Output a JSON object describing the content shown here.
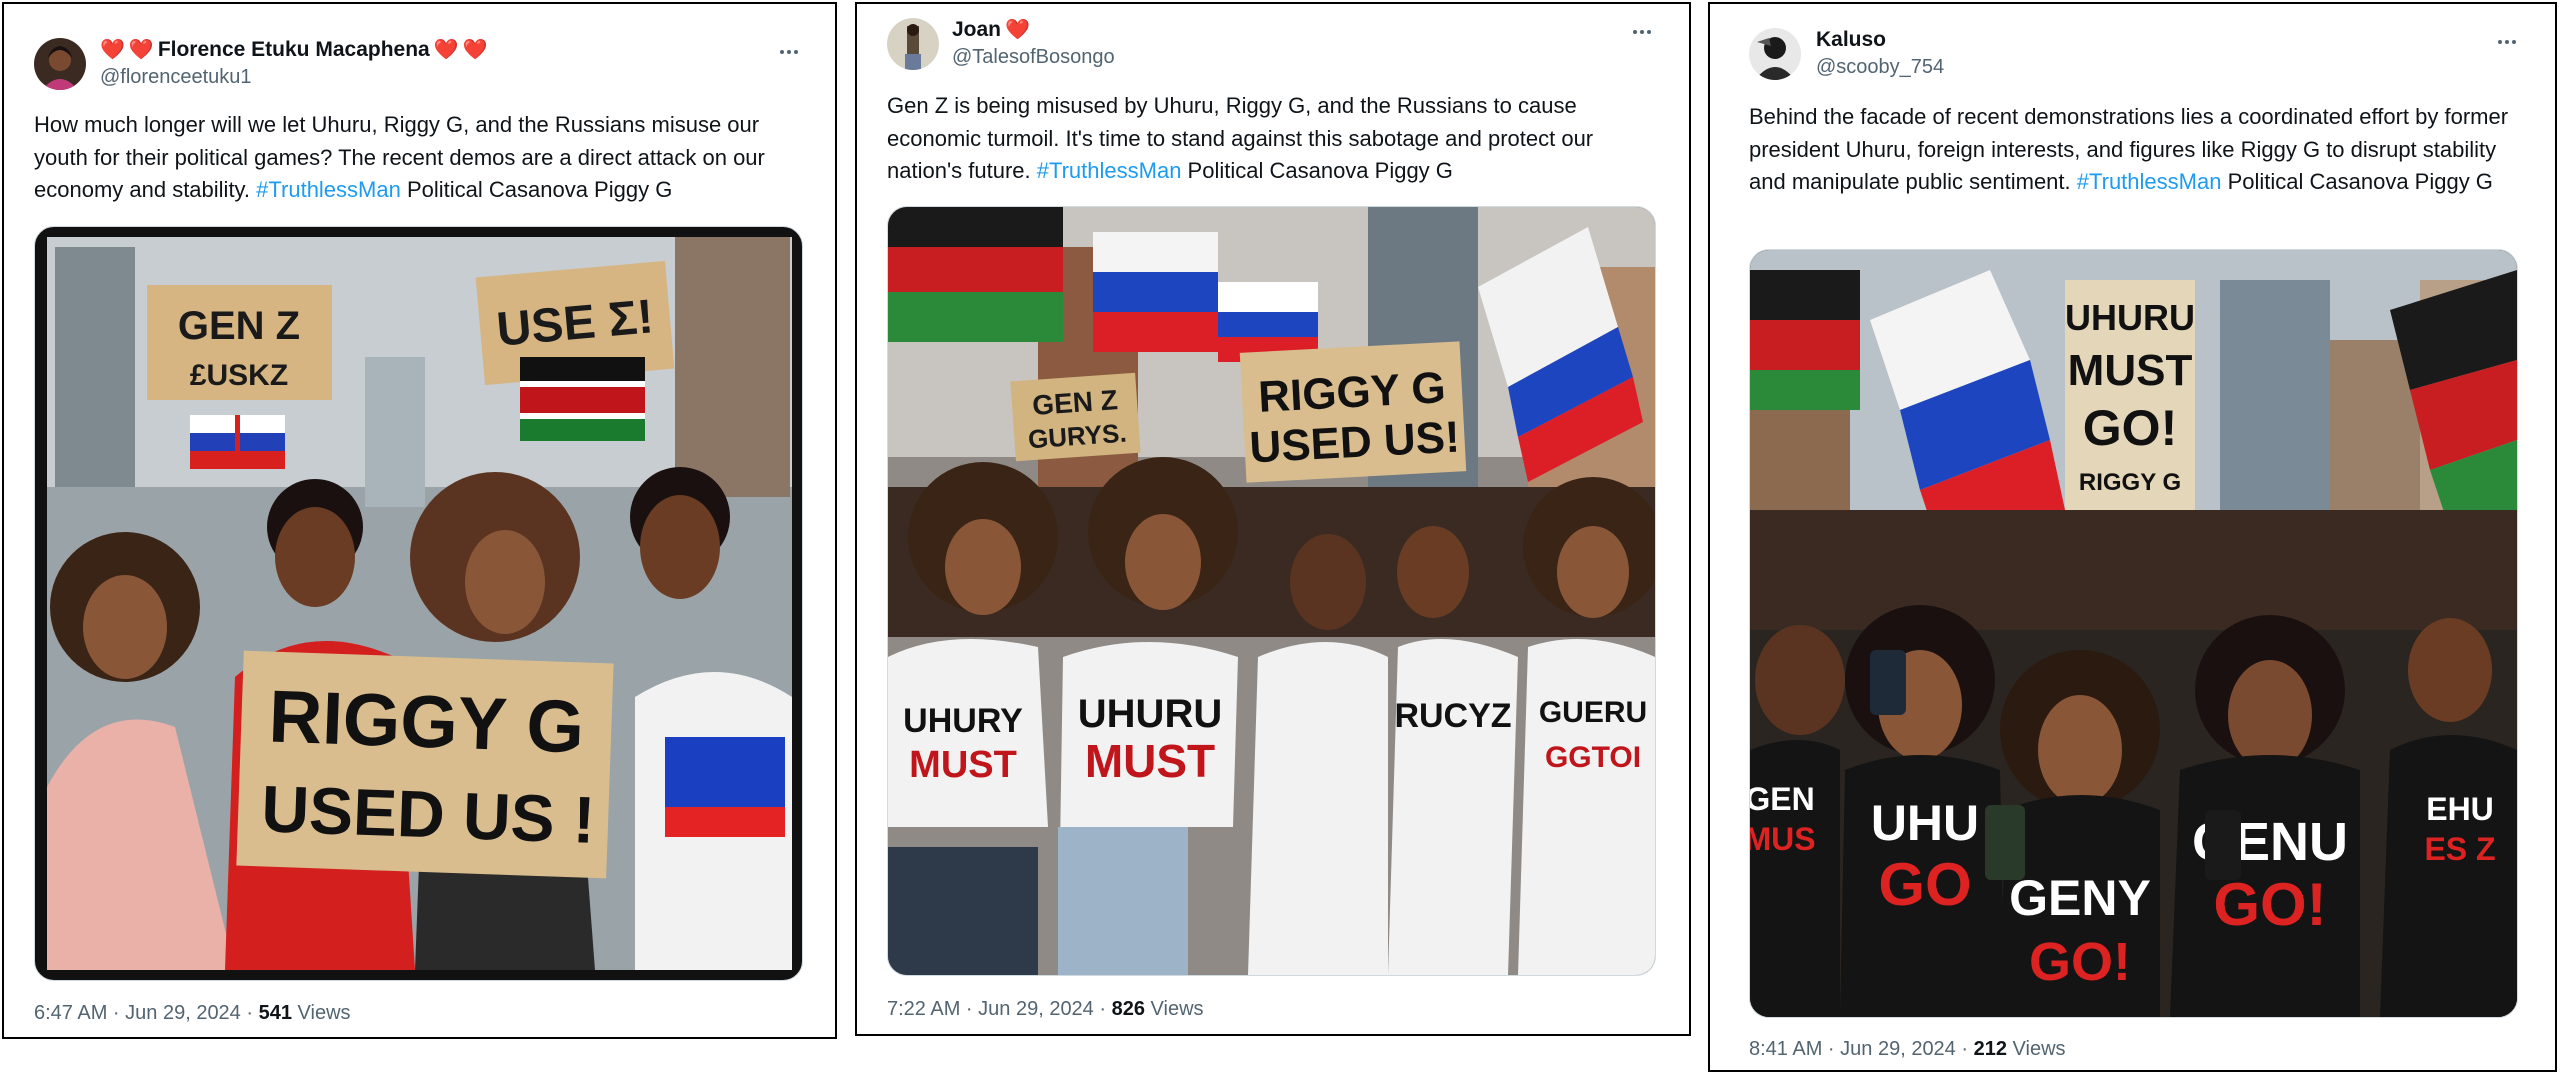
{
  "tweets": [
    {
      "display_name": "Florence Etuku Macaphena",
      "handle": "@florenceetuku1",
      "text_before": "How much longer will we let Uhuru, Riggy G, and the Russians misuse our youth for their political games? The recent demos are a direct attack on our economy and stability. ",
      "hashtag": "#TruthlessMan",
      "text_after": " Political Casanova Piggy G",
      "time": "6:47 AM · Jun 29, 2024 · ",
      "views_count": "541",
      "views_label": " Views",
      "image_signs": [
        "GEN Z",
        "£USKZ",
        "USE Σ!",
        "RIGGY G",
        "USED US !"
      ]
    },
    {
      "display_name": "Joan",
      "handle": "@TalesofBosongo",
      "text_before": "Gen Z is being misused by Uhuru, Riggy G, and the Russians to cause economic turmoil. It's time to stand against this sabotage and protect our nation's future. ",
      "hashtag": "#TruthlessMan",
      "text_after": " Political Casanova Piggy G",
      "time": "7:22 AM · Jun 29, 2024 · ",
      "views_count": "826",
      "views_label": " Views",
      "image_signs": [
        "GEN Z",
        "GURYS.",
        "RIGGY G",
        "USED US!",
        "UHURY",
        "MUST",
        "UHURU",
        "MUST",
        "RUCYZ",
        "GUERU",
        "GGTOI"
      ]
    },
    {
      "display_name": "Kaluso",
      "handle": "@scooby_754",
      "text_before": "Behind the facade of recent demonstrations lies a coordinated effort by former president Uhuru, foreign interests, and figures like Riggy G to disrupt stability and manipulate public sentiment. ",
      "hashtag": "#TruthlessMan",
      "text_after": " Political Casanova Piggy G",
      "time": "8:41 AM · Jun 29, 2024 · ",
      "views_count": "212",
      "views_label": " Views",
      "image_signs": [
        "UHURU",
        "MUST",
        "GO!",
        "RIGGY G",
        "GEN",
        "MUS",
        "UHU",
        "GO",
        "GENU",
        "GO!",
        "GENY",
        "GO!",
        "EHU",
        "ES Z"
      ]
    }
  ],
  "colors": {
    "hashtag": "#1d9bf0",
    "secondary": "#536471",
    "heart": "#f4212e"
  }
}
